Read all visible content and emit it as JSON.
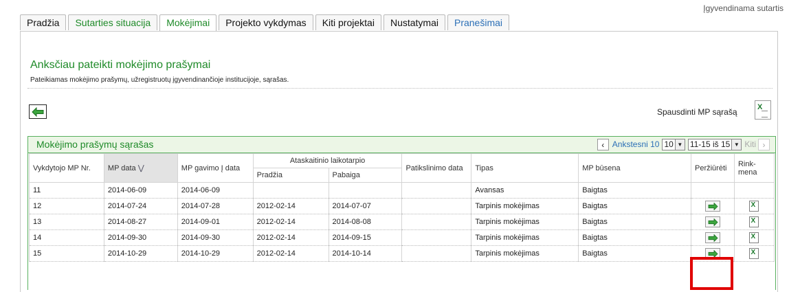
{
  "header": {
    "status": "Įgyvendinama sutartis"
  },
  "tabs": [
    {
      "label": "Pradžia"
    },
    {
      "label": "Sutarties situacija"
    },
    {
      "label": "Mokėjimai"
    },
    {
      "label": "Projekto vykdymas"
    },
    {
      "label": "Kiti projektai"
    },
    {
      "label": "Nustatymai"
    },
    {
      "label": "Pranešimai"
    }
  ],
  "page": {
    "title": "Anksčiau pateikti mokėjimo prašymai",
    "subtitle": "Pateikiamas mokėjimo prašymų, užregistruotų įgyvendinančioje institucijoje, sąrašas.",
    "print_label": "Spausdinti MP sąrašą",
    "back_icon": "left-arrow-icon",
    "excel_icon": "excel-icon"
  },
  "list": {
    "title": "Mokėjimo prašymų sąrašas",
    "pager": {
      "prev_label": "Ankstesni 10",
      "page_size": "10",
      "range": "11-15 iš 15",
      "next_label": "Kiti"
    },
    "columns": {
      "nr": "Vykdytojo MP Nr.",
      "mp_date": "MP data",
      "received": "MP gavimo Į data",
      "period": "Ataskaitinio laikotarpio",
      "period_start": "Pradžia",
      "period_end": "Pabaiga",
      "clarify": "Patikslinimo data",
      "type": "Tipas",
      "status": "MP būsena",
      "view": "Peržiūrėti",
      "export_1": "Rink-",
      "export_2": "mena"
    },
    "rows": [
      {
        "nr": "11",
        "mp_date": "2014-06-09",
        "received": "2014-06-09",
        "start": "",
        "end": "",
        "clarify": "",
        "type": "Avansas",
        "status": "Baigtas",
        "view": false,
        "xls": false
      },
      {
        "nr": "12",
        "mp_date": "2014-07-24",
        "received": "2014-07-28",
        "start": "2012-02-14",
        "end": "2014-07-07",
        "clarify": "",
        "type": "Tarpinis mokėjimas",
        "status": "Baigtas",
        "view": true,
        "xls": true
      },
      {
        "nr": "13",
        "mp_date": "2014-08-27",
        "received": "2014-09-01",
        "start": "2012-02-14",
        "end": "2014-08-08",
        "clarify": "",
        "type": "Tarpinis mokėjimas",
        "status": "Baigtas",
        "view": true,
        "xls": true
      },
      {
        "nr": "14",
        "mp_date": "2014-09-30",
        "received": "2014-09-30",
        "start": "2012-02-14",
        "end": "2014-09-15",
        "clarify": "",
        "type": "Tarpinis mokėjimas",
        "status": "Baigtas",
        "view": true,
        "xls": true
      },
      {
        "nr": "15",
        "mp_date": "2014-10-29",
        "received": "2014-10-29",
        "start": "2012-02-14",
        "end": "2014-10-14",
        "clarify": "",
        "type": "Tarpinis mokėjimas",
        "status": "Baigtas",
        "view": true,
        "xls": true
      }
    ]
  },
  "colors": {
    "accent_green": "#1e8a28",
    "link_blue": "#2b6fb6",
    "highlight_red": "#e00000"
  }
}
